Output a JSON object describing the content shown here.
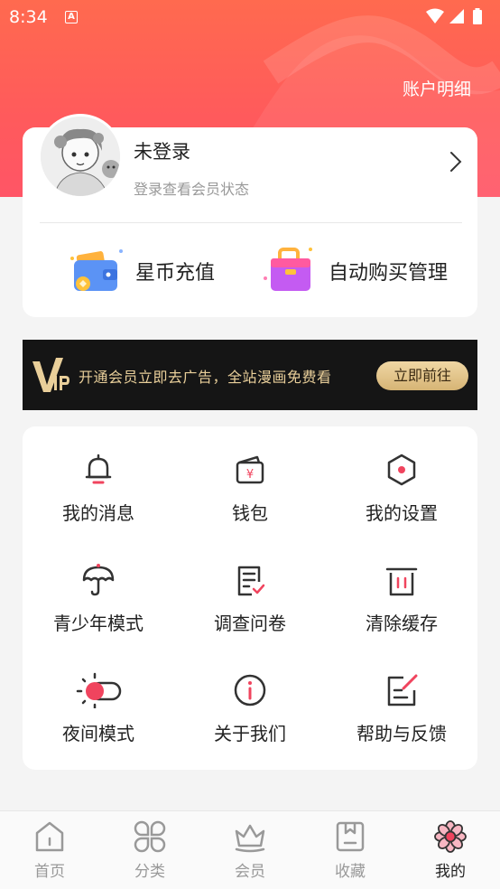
{
  "status_bar": {
    "time": "8:34",
    "notification_letter": "A"
  },
  "header": {
    "account_detail_label": "账户明细"
  },
  "profile": {
    "name": "未登录",
    "subtitle": "登录查看会员状态",
    "quick_actions": [
      {
        "label": "星币充值",
        "icon": "wallet-icon"
      },
      {
        "label": "自动购买管理",
        "icon": "shopping-bag-icon"
      }
    ]
  },
  "vip_banner": {
    "text": "开通会员立即去广告，全站漫画免费看",
    "button_label": "立即前往"
  },
  "menu": {
    "items": [
      {
        "label": "我的消息",
        "icon": "bell-icon"
      },
      {
        "label": "钱包",
        "icon": "wallet-icon"
      },
      {
        "label": "我的设置",
        "icon": "settings-hexagon-icon"
      },
      {
        "label": "青少年模式",
        "icon": "umbrella-icon"
      },
      {
        "label": "调查问卷",
        "icon": "survey-icon"
      },
      {
        "label": "清除缓存",
        "icon": "trash-icon"
      },
      {
        "label": "夜间模式",
        "icon": "night-toggle-icon"
      },
      {
        "label": "关于我们",
        "icon": "info-icon"
      },
      {
        "label": "帮助与反馈",
        "icon": "feedback-icon"
      }
    ]
  },
  "tabbar": {
    "tabs": [
      {
        "label": "首页",
        "icon": "home-icon",
        "active": false
      },
      {
        "label": "分类",
        "icon": "category-icon",
        "active": false
      },
      {
        "label": "会员",
        "icon": "crown-icon",
        "active": false
      },
      {
        "label": "收藏",
        "icon": "bookmark-icon",
        "active": false
      },
      {
        "label": "我的",
        "icon": "flower-icon",
        "active": true
      }
    ]
  },
  "colors": {
    "accent": "#ff5a5c",
    "vip_gold": "#e9cf9a",
    "icon_dark": "#333333"
  }
}
